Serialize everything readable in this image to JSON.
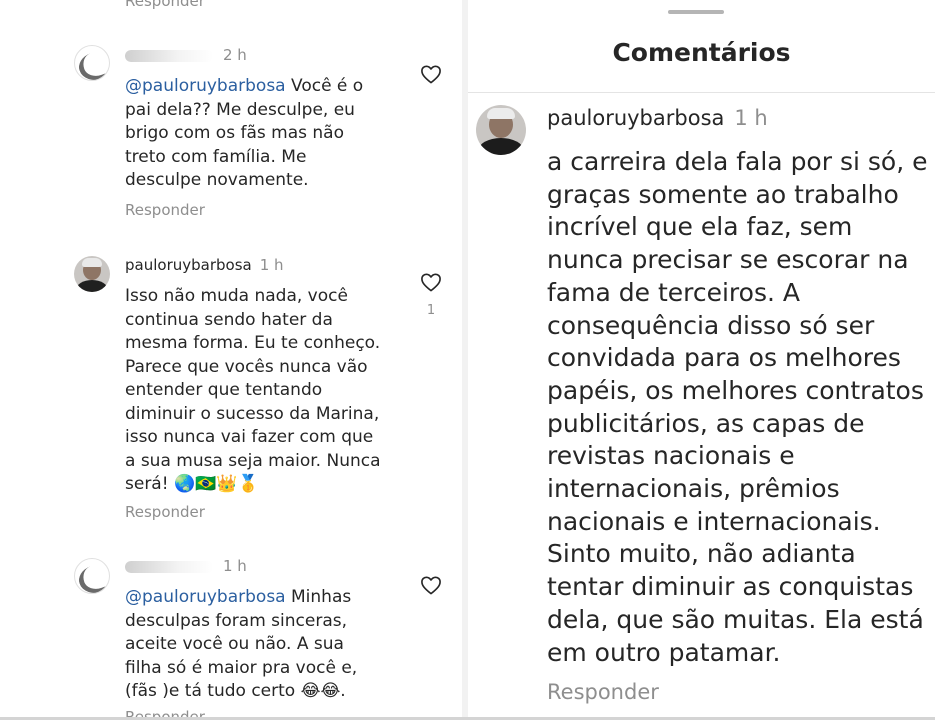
{
  "left_panel": {
    "top_reply_label": "Responder",
    "comments": [
      {
        "username": "",
        "time": "2 h",
        "mention": "@pauloruybarbosa",
        "text": " Você é o\npai dela?? Me desculpe, eu\nbrigo com os fãs mas não\ntreto com família. Me\ndesculpe novamente.",
        "reply_label": "Responder",
        "likes": ""
      },
      {
        "username": "pauloruybarbosa",
        "time": "1 h",
        "mention": "",
        "text": "Isso não muda nada, você\ncontinua sendo hater da\nmesma forma. Eu te conheço.\nParece que vocês nunca vão\nentender que tentando\ndiminuir o sucesso da Marina,\nisso nunca vai fazer com que\na sua musa seja maior. Nunca\nserá! 🌏🇧🇷👑🥇",
        "reply_label": "Responder",
        "likes": "1"
      },
      {
        "username": "",
        "time": "1 h",
        "mention": "@pauloruybarbosa",
        "text": " Minhas\ndesculpas foram sinceras,\naceite você ou não. A sua\nfilha  só é maior pra você e,\n(fãs )e tá tudo certo 😂😂.",
        "reply_label": "Responder",
        "likes": ""
      }
    ]
  },
  "right_panel": {
    "title": "Comentários",
    "comment": {
      "username": "pauloruybarbosa",
      "time": "1 h",
      "text": "a carreira dela fala por si só, e\ngraças somente ao trabalho\nincrível que ela faz, sem\nnunca precisar se escorar na\nfama de terceiros. A\nconsequência disso só ser\nconvidada para os melhores\npapéis, os melhores contratos\npublicitários, as capas de\nrevistas nacionais e\ninternacionais, prêmios\nnacionais e internacionais.\nSinto muito, não adianta\ntentar diminuir as conquistas\ndela, que são muitas. Ela está\nem outro patamar.",
      "reply_label": "Responder"
    }
  },
  "colors": {
    "mention": "#2b5fa0",
    "muted": "#8e8e8e",
    "text": "#262626"
  }
}
